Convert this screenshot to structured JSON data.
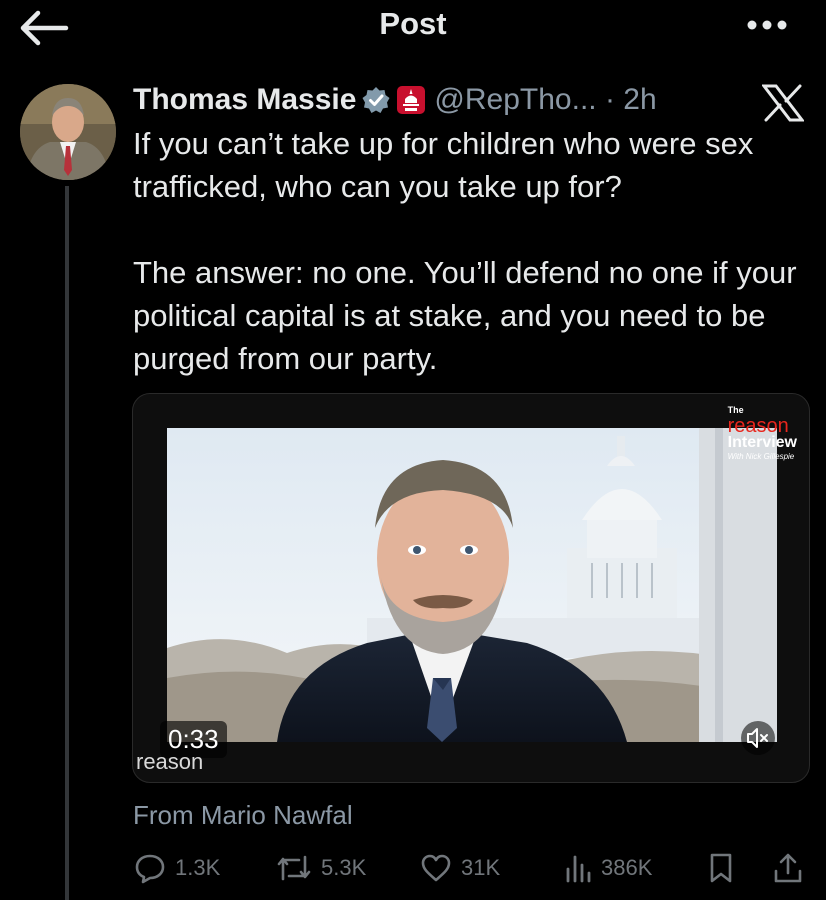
{
  "header": {
    "title": "Post"
  },
  "tweet": {
    "author_name": "Thomas Massie",
    "handle_time": "@RepTho... · 2h",
    "paragraphs": [
      "If you can’t take up for children who were sex trafficked, who can you take up for?",
      "The answer: no one. You’ll defend no one if your political capital is at stake, and you need to be purged from our party."
    ],
    "media": {
      "duration": "0:33",
      "bottom_brand": "reason",
      "logo": {
        "the": "The",
        "reason": "reason",
        "interview": "Interview",
        "with": "With Nick Gillespie"
      }
    },
    "from": "From Mario Nawfal",
    "stats": {
      "replies": "1.3K",
      "reposts": "5.3K",
      "likes": "31K",
      "views": "386K"
    }
  },
  "colors": {
    "background": "#000000",
    "text": "#e7e9ea",
    "muted": "#71767b",
    "verified": "#829aab",
    "reason_red": "#e8261d"
  }
}
